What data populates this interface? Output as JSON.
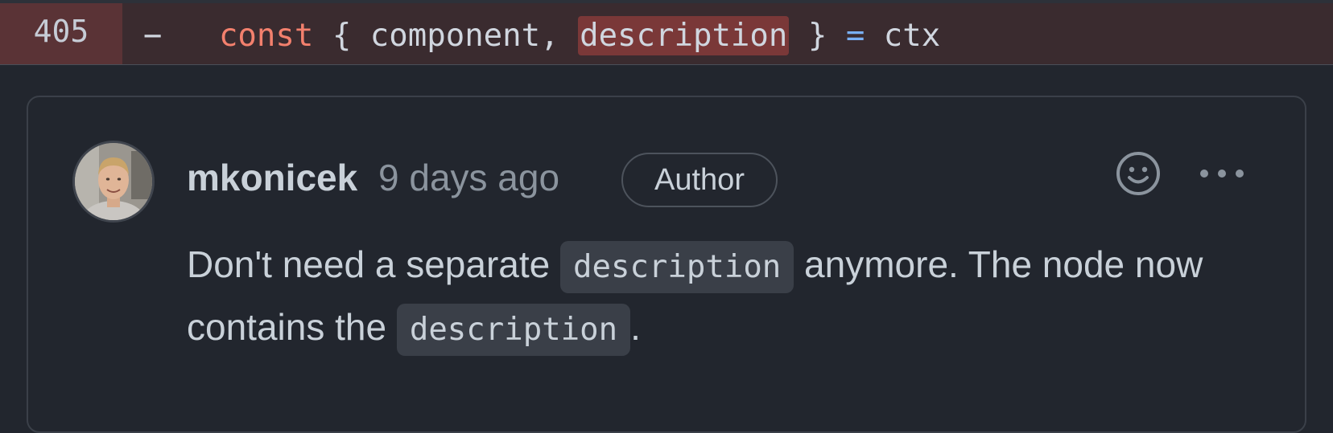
{
  "diff": {
    "line_number": "405",
    "marker": "−",
    "code": {
      "keyword": "const",
      "open_brace": "{",
      "ident1": "component,",
      "highlighted": "description",
      "close_brace": "}",
      "operator": "=",
      "rhs": "ctx"
    }
  },
  "comment": {
    "author": "mkonicek",
    "timestamp": "9 days ago",
    "badge": "Author",
    "body": {
      "part1": "Don't need a separate ",
      "code1": "description",
      "part2": " anymore. The node now contains the ",
      "code2": "description",
      "part3": "."
    },
    "actions": {
      "react_icon": "smiley-icon",
      "more_icon": "kebab-horizontal-icon"
    }
  },
  "colors": {
    "background": "#22262e",
    "diff_removed_bg": "#3a2b2f",
    "diff_removed_gutter": "#5a3336",
    "word_highlight": "#7a3838",
    "keyword": "#f3806d",
    "operator": "#79b0f5",
    "muted_text": "#8b949e",
    "text": "#c9d1d9"
  }
}
